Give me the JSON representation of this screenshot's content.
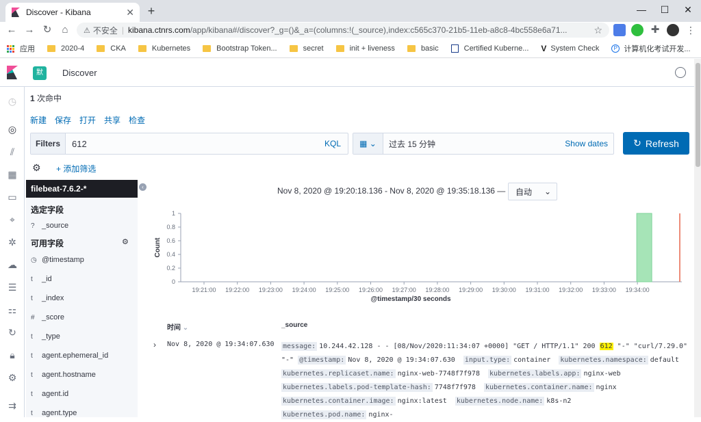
{
  "browser": {
    "tab_title": "Discover - Kibana",
    "insecure_label": "不安全",
    "url_host": "kibana.ctnrs.com",
    "url_path": "/app/kibana#/discover?_g=()&_a=(columns:!(_source),index:c565c370-21b5-11eb-a8c8-4bc558e6a71..."
  },
  "bookmarks": [
    {
      "label": "应用",
      "icon": "apps-grid-icon"
    },
    {
      "label": "2020-4",
      "icon": "folder-icon"
    },
    {
      "label": "CKA",
      "icon": "folder-icon"
    },
    {
      "label": "Kubernetes",
      "icon": "folder-icon"
    },
    {
      "label": "Bootstrap Token...",
      "icon": "folder-icon"
    },
    {
      "label": "secret",
      "icon": "folder-icon"
    },
    {
      "label": "init + liveness",
      "icon": "folder-icon"
    },
    {
      "label": "basic",
      "icon": "folder-icon"
    },
    {
      "label": "Certified Kuberne...",
      "icon": "doc-icon"
    },
    {
      "label": "System Check",
      "icon": "v-icon"
    },
    {
      "label": "计算机化考试开发...",
      "icon": "p-icon"
    }
  ],
  "kibana": {
    "space_avatar": "默",
    "breadcrumb": "Discover",
    "hits_count": "1",
    "hits_label": "次命中",
    "menu": [
      "新建",
      "保存",
      "打开",
      "共享",
      "检查"
    ],
    "filters_label": "Filters",
    "query": "612",
    "kql_label": "KQL",
    "time_range": "过去 15 分钟",
    "show_dates": "Show dates",
    "refresh_label": "Refresh",
    "add_filter": "+ 添加筛选"
  },
  "sidebar": {
    "index_pattern": "filebeat-7.6.2-*",
    "selected_header": "选定字段",
    "selected_fields": [
      {
        "type": "?",
        "name": "_source"
      }
    ],
    "available_header": "可用字段",
    "available_fields": [
      {
        "type": "clock",
        "name": "@timestamp"
      },
      {
        "type": "t",
        "name": "_id"
      },
      {
        "type": "t",
        "name": "_index"
      },
      {
        "type": "#",
        "name": "_score"
      },
      {
        "type": "t",
        "name": "_type"
      },
      {
        "type": "t",
        "name": "agent.ephemeral_id"
      },
      {
        "type": "t",
        "name": "agent.hostname"
      },
      {
        "type": "t",
        "name": "agent.id"
      },
      {
        "type": "t",
        "name": "agent.type"
      }
    ]
  },
  "histogram": {
    "time_range_text": "Nov 8, 2020 @ 19:20:18.136 - Nov 8, 2020 @ 19:35:18.136 —",
    "interval": "自动"
  },
  "chart_data": {
    "type": "bar",
    "x": [
      "19:21:00",
      "19:22:00",
      "19:23:00",
      "19:24:00",
      "19:25:00",
      "19:26:00",
      "19:27:00",
      "19:28:00",
      "19:29:00",
      "19:30:00",
      "19:31:00",
      "19:32:00",
      "19:33:00",
      "19:34:00"
    ],
    "bar_at": "19:34:00",
    "values": [
      1
    ],
    "ylabel": "Count",
    "xlabel": "@timestamp/30 seconds",
    "yticks": [
      "0",
      "0.2",
      "0.4",
      "0.6",
      "0.8",
      "1"
    ],
    "ylim": [
      0,
      1
    ],
    "bar_color": "#a6e4b7",
    "now_line_color": "#e7664c"
  },
  "table": {
    "col_time": "时间",
    "col_source": "_source",
    "row": {
      "time": "Nov 8, 2020 @ 19:34:07.630",
      "message_pre": "10.244.42.128 - - [08/Nov/2020:11:34:07 +0000] \"GET / HTTP/1.1\" 200",
      "message_hl": "612",
      "message_post": "\"-\" \"curl/7.29.0\" \"-\"",
      "fields": [
        {
          "k": "@timestamp:",
          "v": "Nov 8, 2020 @ 19:34:07.630"
        },
        {
          "k": "input.type:",
          "v": "container"
        },
        {
          "k": "kubernetes.namespace:",
          "v": "default"
        },
        {
          "k": "kubernetes.replicaset.name:",
          "v": "nginx-web-7748f7f978"
        },
        {
          "k": "kubernetes.labels.app:",
          "v": "nginx-web"
        },
        {
          "k": "kubernetes.labels.pod-template-hash:",
          "v": "7748f7f978"
        },
        {
          "k": "kubernetes.container.name:",
          "v": "nginx"
        },
        {
          "k": "kubernetes.container.image:",
          "v": "nginx:latest"
        },
        {
          "k": "kubernetes.node.name:",
          "v": "k8s-n2"
        },
        {
          "k": "kubernetes.pod.name:",
          "v": "nginx-"
        }
      ]
    }
  }
}
